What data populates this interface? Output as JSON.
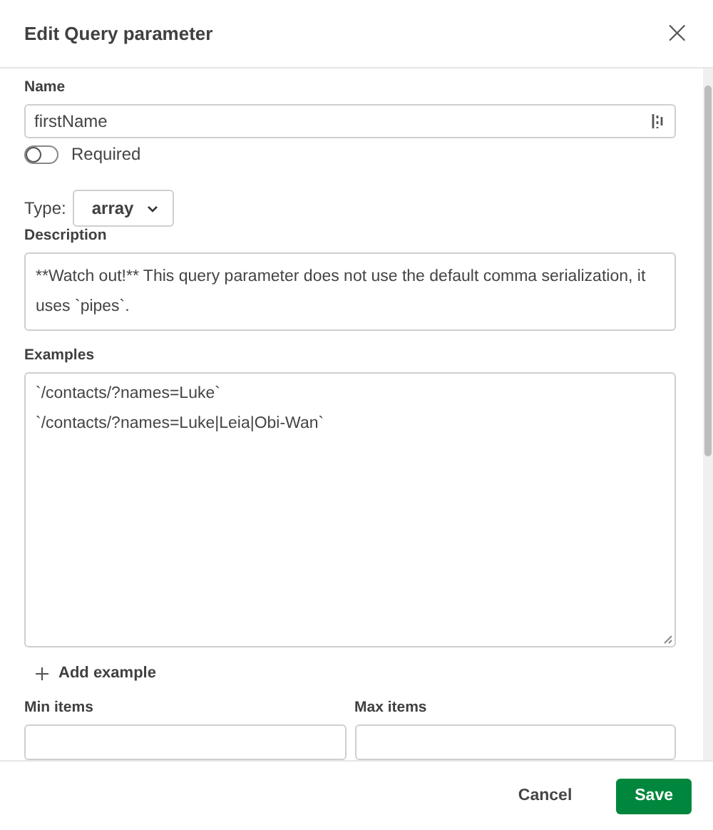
{
  "dialog": {
    "title": "Edit Query parameter",
    "close": "×"
  },
  "name_field": {
    "label": "Name",
    "value": "firstName"
  },
  "required_toggle": {
    "label": "Required",
    "on": false
  },
  "type_select": {
    "label": "Type:",
    "value": "array"
  },
  "description_field": {
    "label": "Description",
    "value": "**Watch out!** This query parameter does not use the default comma serialization, it uses `pipes`."
  },
  "examples_field": {
    "label": "Examples",
    "lines": [
      "`/contacts/?names=Luke`",
      "`/contacts/?names=Luke|Leia|Obi-Wan`"
    ]
  },
  "add_example": {
    "label": "Add example"
  },
  "min_items": {
    "label": "Min items"
  },
  "max_items": {
    "label": "Max items"
  },
  "buttons": [
    {
      "kind": "secondary",
      "label": "Cancel"
    },
    {
      "kind": "primary",
      "label": "Save"
    }
  ]
}
